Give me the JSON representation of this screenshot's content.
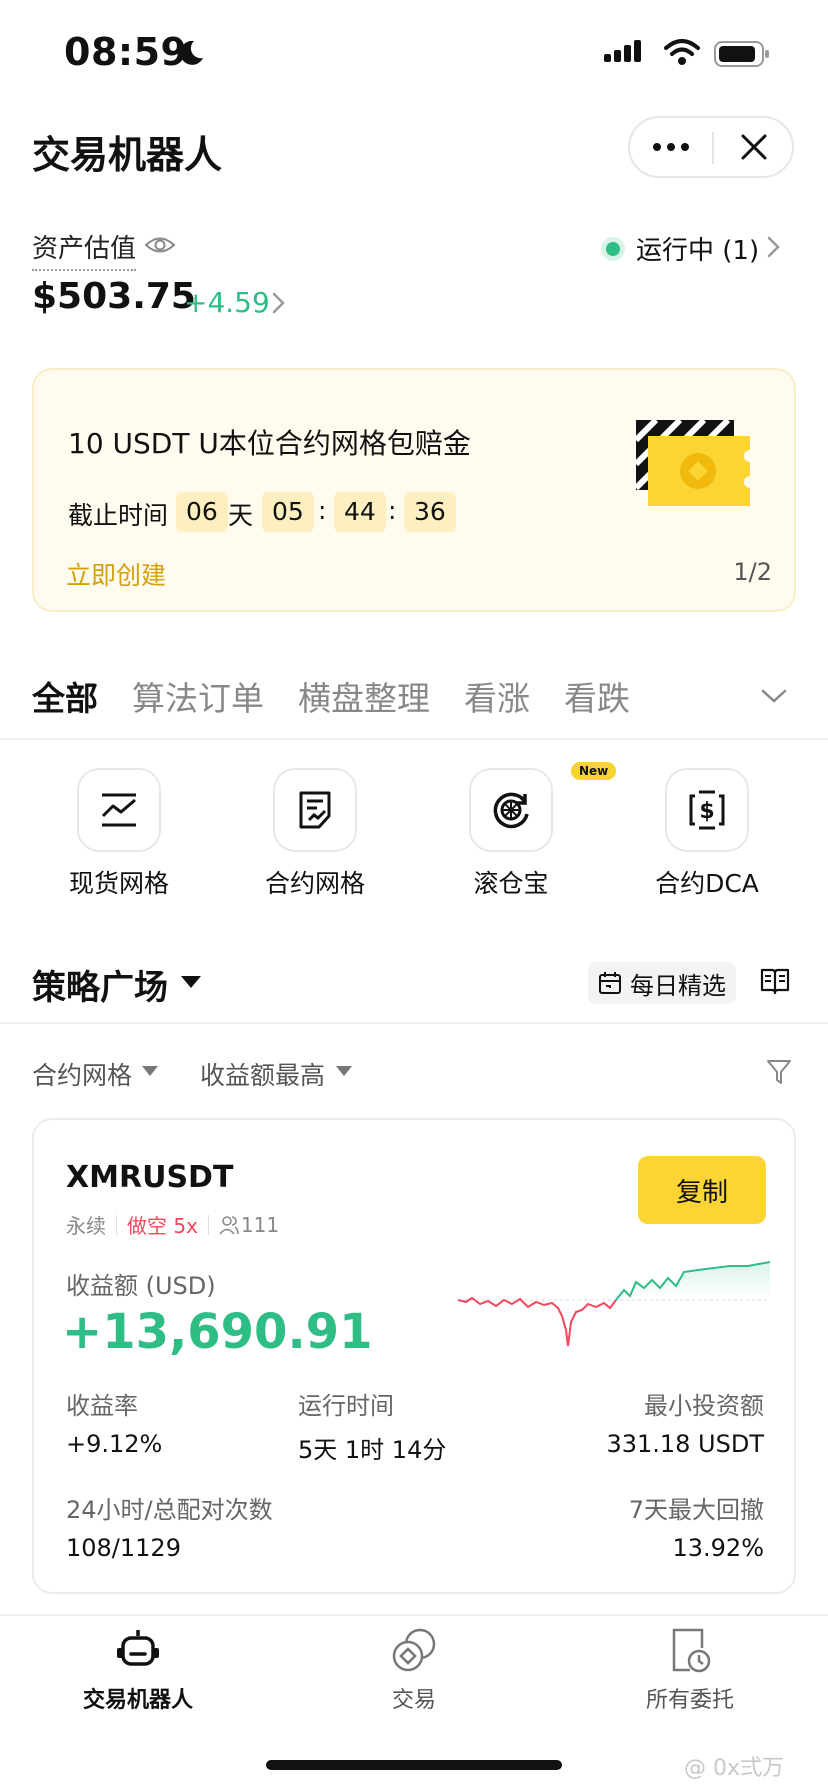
{
  "status_bar": {
    "time": "08:59"
  },
  "header": {
    "title": "交易机器人"
  },
  "assets": {
    "label": "资产估值",
    "value": "$503.75",
    "change": "+4.59",
    "running_label": "运行中 (1)"
  },
  "promo": {
    "title": "10 USDT U本位合约网格包赔金",
    "deadline_label": "截止时间",
    "days": "06",
    "day_unit": "天",
    "hours": "05",
    "minutes": "44",
    "seconds": "36",
    "sep": ":",
    "cta": "立即创建",
    "pager": "1/2"
  },
  "tabs": [
    "全部",
    "算法订单",
    "横盘整理",
    "看涨",
    "看跌"
  ],
  "quick_actions": [
    {
      "label": "现货网格",
      "icon": "spot-grid-icon"
    },
    {
      "label": "合约网格",
      "icon": "futures-grid-icon"
    },
    {
      "label": "滚仓宝",
      "icon": "rollover-icon",
      "badge": "New"
    },
    {
      "label": "合约DCA",
      "icon": "futures-dca-icon"
    }
  ],
  "plaza": {
    "title": "策略广场",
    "daily_label": "每日精选",
    "filter_type": "合约网格",
    "filter_sort": "收益额最高"
  },
  "strategy": {
    "symbol": "XMRUSDT",
    "copy_label": "复制",
    "tag_perp": "永续",
    "tag_side": "做空 5x",
    "followers": "111",
    "pnl_label": "收益额 (USD)",
    "pnl_value": "+13,690.91",
    "roi_label": "收益率",
    "roi_value": "+9.12%",
    "runtime_label": "运行时间",
    "runtime_value": "5天 1时 14分",
    "min_invest_label": "最小投资额",
    "min_invest_value": "331.18 USDT",
    "matches_label": "24小时/总配对次数",
    "matches_value": "108/1129",
    "drawdown_label": "7天最大回撤",
    "drawdown_value": "13.92%"
  },
  "bottom_nav": [
    {
      "label": "交易机器人",
      "icon": "robot-icon",
      "active": true
    },
    {
      "label": "交易",
      "icon": "trade-icon",
      "active": false
    },
    {
      "label": "所有委托",
      "icon": "orders-icon",
      "active": false
    }
  ],
  "watermark": "@ 0x弍万",
  "colors": {
    "accent": "#fcd535",
    "up": "#2ebd85",
    "down": "#f6465d"
  }
}
